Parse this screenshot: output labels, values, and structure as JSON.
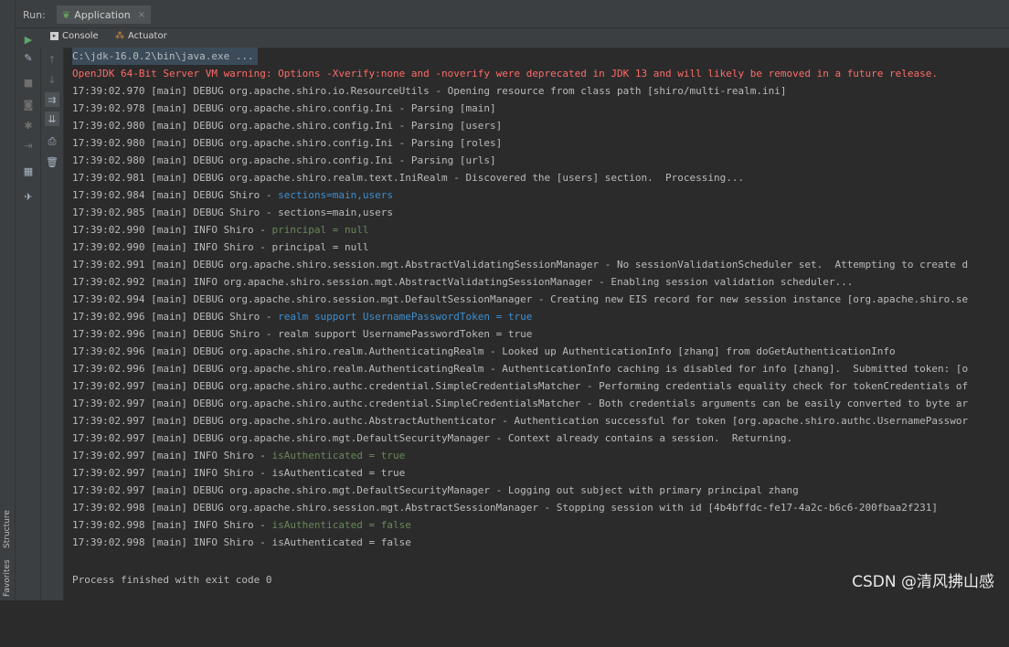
{
  "header": {
    "run_label": "Run:",
    "app_tab": "Application",
    "close": "×"
  },
  "subtabs": {
    "console": "Console",
    "actuator": "Actuator"
  },
  "side_tabs": {
    "structure": "Structure",
    "favorites": "Favorites"
  },
  "console": {
    "command": "C:\\jdk-16.0.2\\bin\\java.exe ...",
    "warning": "OpenJDK 64-Bit Server VM warning: Options -Xverify:none and -noverify were deprecated in JDK 13 and will likely be removed in a future release.",
    "lines": [
      {
        "prefix": "17:39:02.970 [main] DEBUG org.apache.shiro.io.ResourceUtils - Opening resource from class path [shiro/multi-realm.ini]",
        "rest": ""
      },
      {
        "prefix": "17:39:02.978 [main] DEBUG org.apache.shiro.config.Ini - Parsing [main]",
        "rest": ""
      },
      {
        "prefix": "17:39:02.980 [main] DEBUG org.apache.shiro.config.Ini - Parsing [users]",
        "rest": ""
      },
      {
        "prefix": "17:39:02.980 [main] DEBUG org.apache.shiro.config.Ini - Parsing [roles]",
        "rest": ""
      },
      {
        "prefix": "17:39:02.980 [main] DEBUG org.apache.shiro.config.Ini - Parsing [urls]",
        "rest": ""
      },
      {
        "prefix": "17:39:02.981 [main] DEBUG org.apache.shiro.realm.text.IniRealm - Discovered the [users] section.  Processing...",
        "rest": ""
      },
      {
        "prefix": "17:39:02.984 [main] DEBUG Shiro - ",
        "rest": "sections=main,users",
        "color": "blue"
      },
      {
        "prefix": "17:39:02.985 [main] DEBUG Shiro - sections=main,users",
        "rest": ""
      },
      {
        "prefix": "17:39:02.990 [main] INFO Shiro - ",
        "rest": "principal = null",
        "color": "green"
      },
      {
        "prefix": "17:39:02.990 [main] INFO Shiro - principal = null",
        "rest": ""
      },
      {
        "prefix": "17:39:02.991 [main] DEBUG org.apache.shiro.session.mgt.AbstractValidatingSessionManager - No sessionValidationScheduler set.  Attempting to create d",
        "rest": ""
      },
      {
        "prefix": "17:39:02.992 [main] INFO org.apache.shiro.session.mgt.AbstractValidatingSessionManager - Enabling session validation scheduler...",
        "rest": ""
      },
      {
        "prefix": "17:39:02.994 [main] DEBUG org.apache.shiro.session.mgt.DefaultSessionManager - Creating new EIS record for new session instance [org.apache.shiro.se",
        "rest": ""
      },
      {
        "prefix": "17:39:02.996 [main] DEBUG Shiro - ",
        "rest": "realm support UsernamePasswordToken = true",
        "color": "blue"
      },
      {
        "prefix": "17:39:02.996 [main] DEBUG Shiro - realm support UsernamePasswordToken = true",
        "rest": ""
      },
      {
        "prefix": "17:39:02.996 [main] DEBUG org.apache.shiro.realm.AuthenticatingRealm - Looked up AuthenticationInfo [zhang] from doGetAuthenticationInfo",
        "rest": ""
      },
      {
        "prefix": "17:39:02.996 [main] DEBUG org.apache.shiro.realm.AuthenticatingRealm - AuthenticationInfo caching is disabled for info [zhang].  Submitted token: [o",
        "rest": ""
      },
      {
        "prefix": "17:39:02.997 [main] DEBUG org.apache.shiro.authc.credential.SimpleCredentialsMatcher - Performing credentials equality check for tokenCredentials of",
        "rest": ""
      },
      {
        "prefix": "17:39:02.997 [main] DEBUG org.apache.shiro.authc.credential.SimpleCredentialsMatcher - Both credentials arguments can be easily converted to byte ar",
        "rest": ""
      },
      {
        "prefix": "17:39:02.997 [main] DEBUG org.apache.shiro.authc.AbstractAuthenticator - Authentication successful for token [org.apache.shiro.authc.UsernamePasswor",
        "rest": ""
      },
      {
        "prefix": "17:39:02.997 [main] DEBUG org.apache.shiro.mgt.DefaultSecurityManager - Context already contains a session.  Returning.",
        "rest": ""
      },
      {
        "prefix": "17:39:02.997 [main] INFO Shiro - ",
        "rest": "isAuthenticated = true",
        "color": "green"
      },
      {
        "prefix": "17:39:02.997 [main] INFO Shiro - isAuthenticated = true",
        "rest": ""
      },
      {
        "prefix": "17:39:02.997 [main] DEBUG org.apache.shiro.mgt.DefaultSecurityManager - Logging out subject with primary principal zhang",
        "rest": ""
      },
      {
        "prefix": "17:39:02.998 [main] DEBUG org.apache.shiro.session.mgt.AbstractSessionManager - Stopping session with id [4b4bffdc-fe17-4a2c-b6c6-200fbaa2f231]",
        "rest": ""
      },
      {
        "prefix": "17:39:02.998 [main] INFO Shiro - ",
        "rest": "isAuthenticated = false",
        "color": "green"
      },
      {
        "prefix": "17:39:02.998 [main] INFO Shiro - isAuthenticated = false",
        "rest": ""
      }
    ],
    "exit": "Process finished with exit code 0"
  },
  "watermark": "CSDN @清风拂山感",
  "colors": {
    "warning": "#ff6b68",
    "blue": "#3d8fd1",
    "green": "#6a8759",
    "text": "#bbbbbb",
    "background": "#2b2b2b"
  },
  "icons": {
    "rerun": "run-icon",
    "wrench": "wrench-icon",
    "stop": "stop-icon",
    "camera": "camera-icon",
    "bug": "bug-icon",
    "login": "login-icon",
    "layout": "layout-icon",
    "pin": "pin-icon",
    "up": "up-arrow-icon",
    "down": "down-arrow-icon",
    "wrap": "soft-wrap-icon",
    "scroll": "scroll-to-end-icon",
    "print": "print-icon",
    "trash": "trash-icon"
  }
}
